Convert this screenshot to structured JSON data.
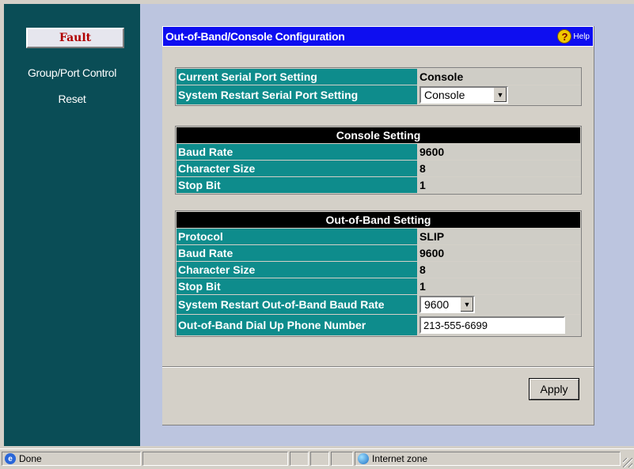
{
  "sidebar": {
    "fault_label": "Fault",
    "links": [
      "Group/Port Control",
      "Reset"
    ]
  },
  "panel": {
    "title": "Out-of-Band/Console Configuration",
    "help_label": "Help"
  },
  "serial": {
    "current_label": "Current Serial Port Setting",
    "current_value": "Console",
    "restart_label": "System Restart Serial Port Setting",
    "restart_value": "Console"
  },
  "console": {
    "header": "Console Setting",
    "baud_label": "Baud Rate",
    "baud_value": "9600",
    "char_label": "Character Size",
    "char_value": "8",
    "stop_label": "Stop Bit",
    "stop_value": "1"
  },
  "oob": {
    "header": "Out-of-Band Setting",
    "protocol_label": "Protocol",
    "protocol_value": "SLIP",
    "baud_label": "Baud Rate",
    "baud_value": "9600",
    "char_label": "Character Size",
    "char_value": "8",
    "stop_label": "Stop Bit",
    "stop_value": "1",
    "restart_baud_label": "System Restart Out-of-Band Baud Rate",
    "restart_baud_value": "9600",
    "phone_label": "Out-of-Band Dial Up Phone Number",
    "phone_value": "213-555-6699"
  },
  "apply_label": "Apply",
  "status": {
    "text": "Done",
    "zone": "Internet zone"
  },
  "colors": {
    "sidebar": "#0a4d56",
    "title_bar": "#0e0ef0",
    "label_cell": "#0e8c8c",
    "main_bg": "#bcc5df"
  },
  "icons": [
    "help-icon",
    "dropdown-arrow-icon",
    "ie-page-icon",
    "internet-zone-icon",
    "resize-grip-icon"
  ]
}
